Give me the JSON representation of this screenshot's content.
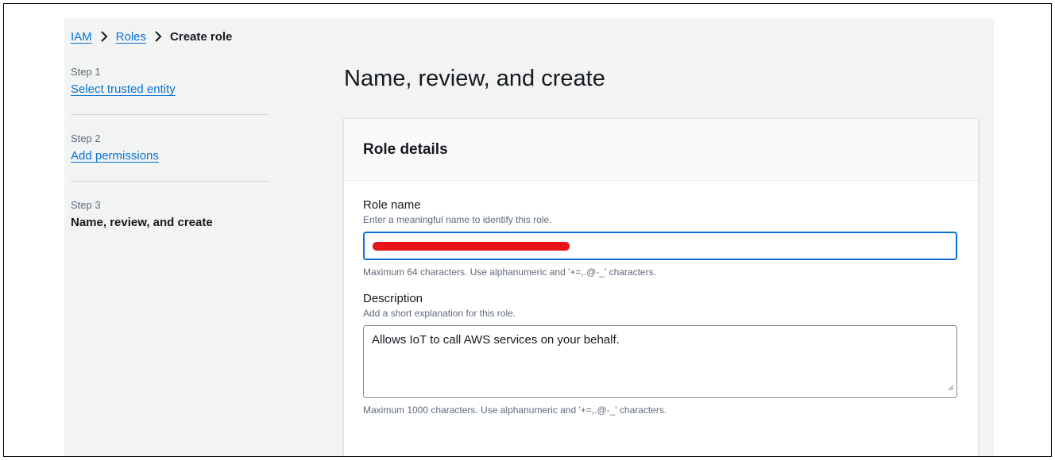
{
  "breadcrumb": {
    "items": [
      "IAM",
      "Roles"
    ],
    "current": "Create role"
  },
  "steps": [
    {
      "label": "Step 1",
      "title": "Select trusted entity"
    },
    {
      "label": "Step 2",
      "title": "Add permissions"
    },
    {
      "label": "Step 3",
      "title": "Name, review, and create"
    }
  ],
  "page": {
    "title": "Name, review, and create"
  },
  "role_details": {
    "title": "Role details",
    "role_name": {
      "label": "Role name",
      "description": "Enter a meaningful name to identify this role.",
      "hint": "Maximum 64 characters. Use alphanumeric and '+=,.@-_' characters."
    },
    "description": {
      "label": "Description",
      "description": "Add a short explanation for this role.",
      "value": "Allows IoT to call AWS services on your behalf.",
      "hint": "Maximum 1000 characters. Use alphanumeric and '+=,.@-_' characters."
    }
  },
  "colors": {
    "link": "#0972d3",
    "focus_border": "#0972d3",
    "redaction": "#e8141c",
    "canvas": "#f2f3f3"
  }
}
